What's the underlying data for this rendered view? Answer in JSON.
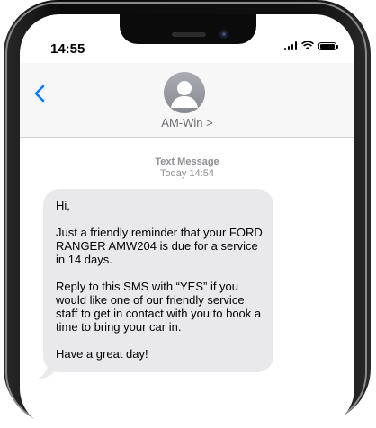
{
  "status_bar": {
    "time": "14:55"
  },
  "header": {
    "back_icon": "chevron-left-icon",
    "contact_name": "AM-Win",
    "contact_chevron": ">"
  },
  "thread": {
    "label": "Text Message",
    "timestamp": "Today 14:54"
  },
  "message": {
    "paragraphs": [
      "Hi,",
      "Just a friendly reminder that your FORD RANGER AMW204 is due for a service in 14 days.",
      "Reply to this SMS with “YES” if you would like one of our friendly service staff to get in contact with you to book a time to bring your car in.",
      "Have a great day!"
    ]
  },
  "colors": {
    "accent": "#007aff",
    "bubble": "#e9e9eb",
    "header_bg": "#f7f7f7"
  }
}
